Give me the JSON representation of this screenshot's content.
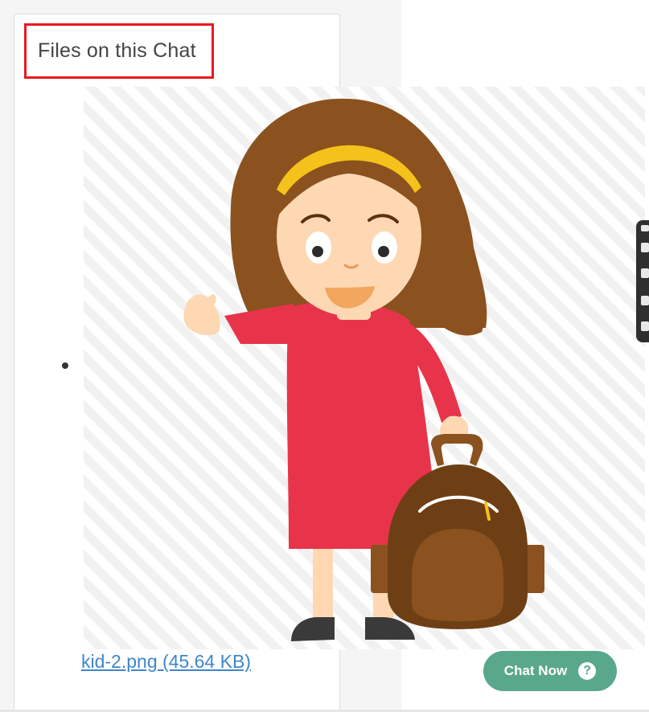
{
  "panel": {
    "title": "Files on this Chat"
  },
  "file": {
    "link_text": "kid-2.png (45.64 KB)",
    "preview_icon": "girl-with-backpack-illustration"
  },
  "chat_widget": {
    "label": "Chat Now",
    "help_glyph": "?",
    "color": "#5aa88b"
  },
  "colors": {
    "highlight_border": "#e8191f",
    "link": "#3f86c9"
  }
}
